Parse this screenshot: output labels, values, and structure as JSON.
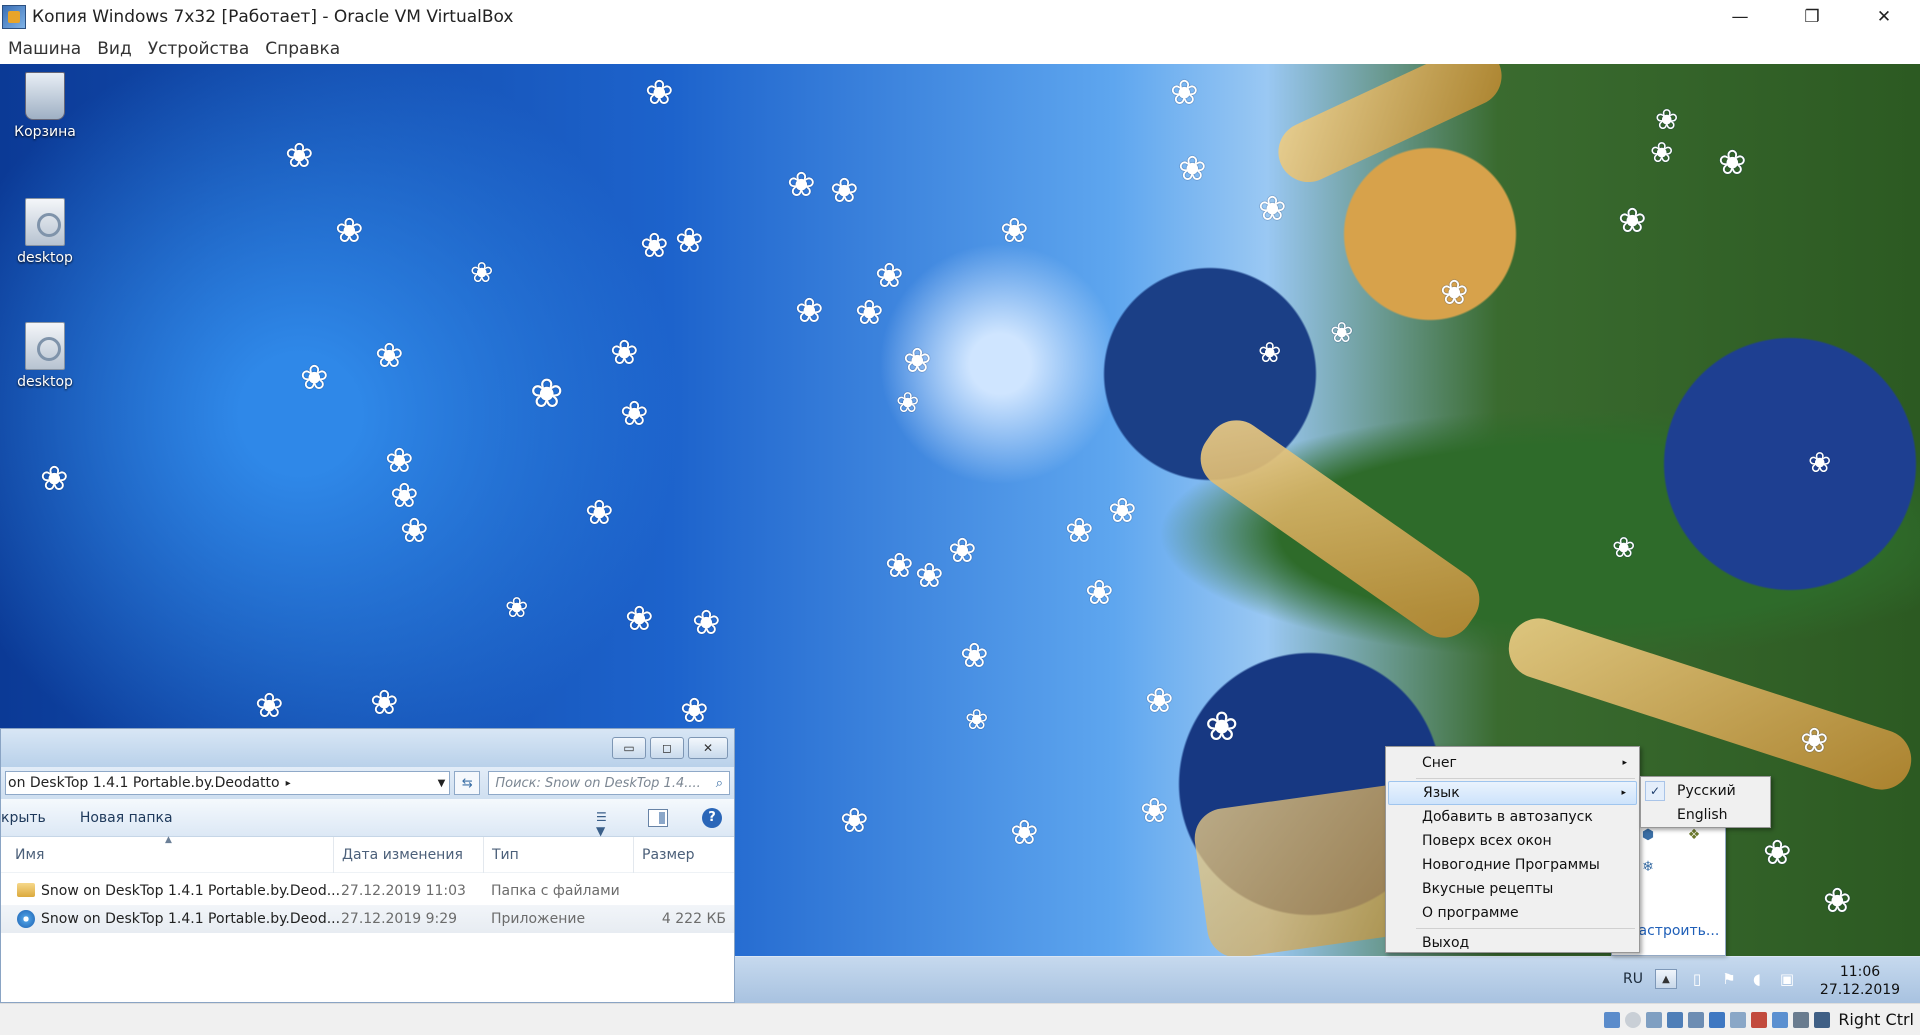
{
  "vbox": {
    "title": "Копия Windows 7x32 [Работает] - Oracle VM VirtualBox",
    "window_controls": {
      "minimize": "—",
      "restore": "❐",
      "close": "✕"
    },
    "menu": [
      "Машина",
      "Вид",
      "Устройства",
      "Справка"
    ],
    "host_key": "Right Ctrl"
  },
  "desktop": {
    "icons": [
      {
        "label": "Корзина"
      },
      {
        "label": "desktop"
      },
      {
        "label": "desktop"
      }
    ],
    "snowflake_glyph": "❀"
  },
  "explorer": {
    "controls": {
      "minimize": "▭",
      "maximize": "◻",
      "close": "✕"
    },
    "address": "on DeskTop 1.4.1 Portable.by.Deodatto",
    "address_arrow": "▸",
    "address_dropdown": "▼",
    "refresh_glyph": "⇆",
    "search_placeholder": "Поиск: Snow on DeskTop 1.4....",
    "search_glyph": "⌕",
    "toolbar": {
      "open": "крыть",
      "new_folder": "Новая папка",
      "view_dropdown": "▼",
      "help": "?"
    },
    "columns": {
      "name": "Имя",
      "modified": "Дата изменения",
      "type": "Тип",
      "size": "Размер"
    },
    "sort_glyph": "▲",
    "rows": [
      {
        "name": "Snow on DeskTop 1.4.1 Portable.by.Deod...",
        "modified": "27.12.2019 11:03",
        "type": "Папка с файлами",
        "size": ""
      },
      {
        "name": "Snow on DeskTop 1.4.1 Portable.by.Deod...",
        "modified": "27.12.2019 9:29",
        "type": "Приложение",
        "size": "4 222 КБ"
      }
    ]
  },
  "taskbar": {
    "language": "RU",
    "tray_arrow": "▲",
    "time": "11:06",
    "date": "27.12.2019"
  },
  "tray_panel": {
    "customize": "Настроить..."
  },
  "context_menu": {
    "submenu_arrow": "▸",
    "items": [
      "Снег",
      "Язык",
      "Добавить в автозапуск",
      "Поверх всех окон",
      "Новогодние Программы",
      "Вкусные рецепты",
      "О программе",
      "Выход"
    ],
    "language_submenu": {
      "items": [
        "Русский",
        "English"
      ],
      "checked": "✓"
    }
  }
}
